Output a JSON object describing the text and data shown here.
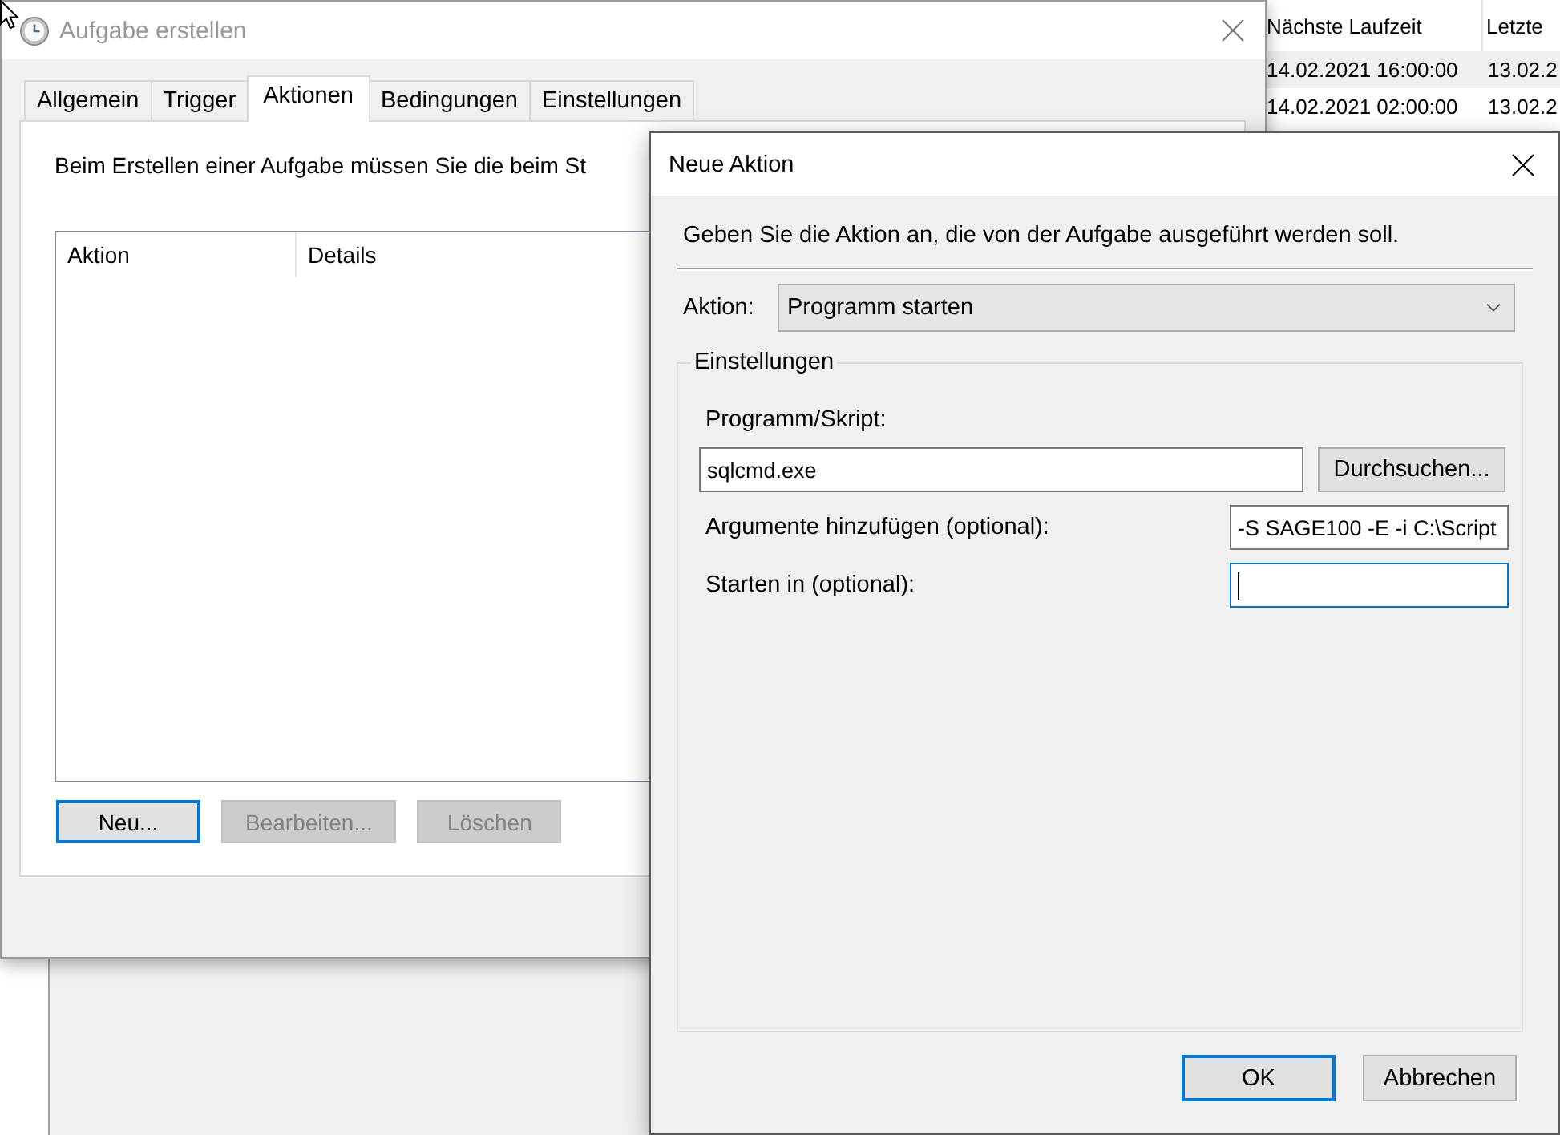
{
  "background_window": {
    "table": {
      "columns": [
        "Nächste Laufzeit",
        "Letzte"
      ],
      "rows": [
        {
          "cells": [
            "14.02.2021 16:00:00",
            "13.02.2"
          ],
          "selected": true
        },
        {
          "cells": [
            "14.02.2021 02:00:00",
            "13.02.2"
          ],
          "selected": false
        }
      ]
    }
  },
  "main_window": {
    "title": "Aufgabe erstellen",
    "active": false,
    "tabs": [
      {
        "label": "Allgemein",
        "selected": false
      },
      {
        "label": "Trigger",
        "selected": false
      },
      {
        "label": "Aktionen",
        "selected": true
      },
      {
        "label": "Bedingungen",
        "selected": false
      },
      {
        "label": "Einstellungen",
        "selected": false
      }
    ],
    "description": "Beim Erstellen einer Aufgabe müssen Sie die beim St",
    "list": {
      "columns": [
        "Aktion",
        "Details"
      ]
    },
    "buttons": [
      {
        "label": "Neu...",
        "disabled": false,
        "focused": true
      },
      {
        "label": "Bearbeiten...",
        "disabled": true,
        "focused": false
      },
      {
        "label": "Löschen",
        "disabled": true,
        "focused": false
      }
    ]
  },
  "dialog": {
    "title": "Neue Aktion",
    "active": true,
    "description": "Geben Sie die Aktion an, die von der Aufgabe ausgeführt werden soll.",
    "action": {
      "label": "Aktion:",
      "value": "Programm starten"
    },
    "settings": {
      "title": "Einstellungen",
      "fields": [
        {
          "kind": "stacked",
          "label": "Programm/Skript:",
          "value": "sqlcmd.exe",
          "button": "Durchsuchen...",
          "focused": false
        },
        {
          "kind": "inline",
          "label": "Argumente hinzufügen (optional):",
          "value": "-S SAGE100 -E -i C:\\Script",
          "focused": false
        },
        {
          "kind": "inline",
          "label": "Starten in (optional):",
          "focused": true
        }
      ]
    },
    "buttons": [
      {
        "label": "OK",
        "default": true
      },
      {
        "label": "Abbrechen",
        "default": false
      }
    ]
  }
}
